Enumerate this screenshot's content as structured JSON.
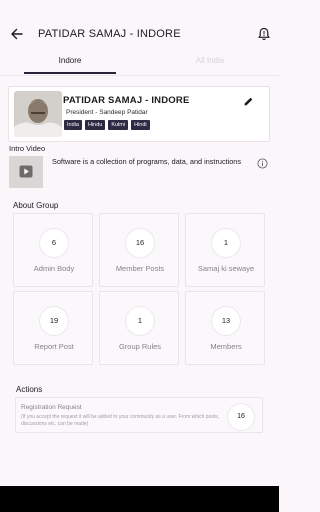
{
  "appbar": {
    "title": "PATIDAR SAMAJ - INDORE"
  },
  "tabs": [
    {
      "label": "Indore"
    },
    {
      "label": "All India"
    }
  ],
  "group": {
    "name": "PATIDAR SAMAJ - INDORE",
    "president": "President - Sandeep Patidar",
    "tags": [
      "India",
      "Hindu",
      "Kulmi",
      "Hindi"
    ]
  },
  "intro": {
    "label": "Intro Video",
    "text": "Software is a collection of programs, data, and instructions"
  },
  "about": {
    "label": "About Group",
    "stats": [
      {
        "value": "6",
        "label": "Admin Body"
      },
      {
        "value": "16",
        "label": "Member Posts"
      },
      {
        "value": "1",
        "label": "Samaj ki sewaye"
      },
      {
        "value": "19",
        "label": "Report Post"
      },
      {
        "value": "1",
        "label": "Group Rules"
      },
      {
        "value": "13",
        "label": "Members"
      }
    ]
  },
  "actions": {
    "label": "Actions",
    "registration": {
      "title": "Registration Request",
      "description": "(If you accept the request it will be added to your community as a user. From which posts, discussions etc. can be made)",
      "count": "16"
    }
  },
  "colors": {
    "accent": "#2f2a44",
    "tab_inactive": "#d7d2dc",
    "muted_text": "#858190"
  }
}
